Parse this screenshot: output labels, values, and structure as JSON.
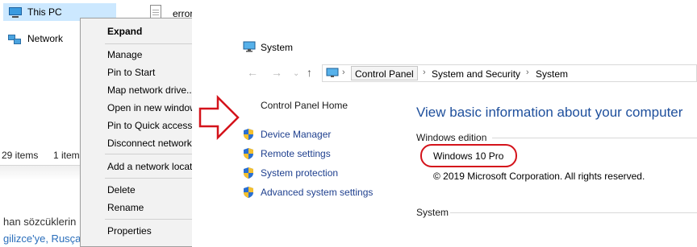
{
  "explorer": {
    "nav": {
      "this_pc": "This PC",
      "network": "Network"
    },
    "file_name": "error",
    "status": {
      "items": "29 items",
      "selected": "1 item"
    },
    "background_text": {
      "line1": "han sözcüklerin",
      "line2": "gilizce'ye, Rusça"
    }
  },
  "context_menu": {
    "items": [
      "Expand",
      "Manage",
      "Pin to Start",
      "Map network drive...",
      "Open in new window",
      "Pin to Quick access",
      "Disconnect network drive...",
      "Add a network location",
      "Delete",
      "Rename",
      "Properties"
    ]
  },
  "system_window": {
    "title": "System",
    "address": {
      "seg1": "Control Panel",
      "seg2": "System and Security",
      "seg3": "System"
    },
    "sidebar": {
      "home": "Control Panel Home",
      "links": [
        "Device Manager",
        "Remote settings",
        "System protection",
        "Advanced system settings"
      ]
    },
    "main": {
      "heading": "View basic information about your computer",
      "edition_label": "Windows edition",
      "version": "Windows 10 Pro",
      "copyright": "© 2019 Microsoft Corporation. All rights reserved.",
      "system_label": "System"
    }
  },
  "colors": {
    "accent": "#1e4f9c",
    "highlight": "#cce8ff",
    "annotation_red": "#d4131b",
    "link": "#1e3f8e"
  },
  "icons": [
    "this-pc-icon",
    "network-icon",
    "file-icon",
    "red-arrow-icon",
    "system-icon",
    "shield-icon",
    "back-arrow-icon",
    "forward-arrow-icon",
    "up-arrow-icon"
  ]
}
